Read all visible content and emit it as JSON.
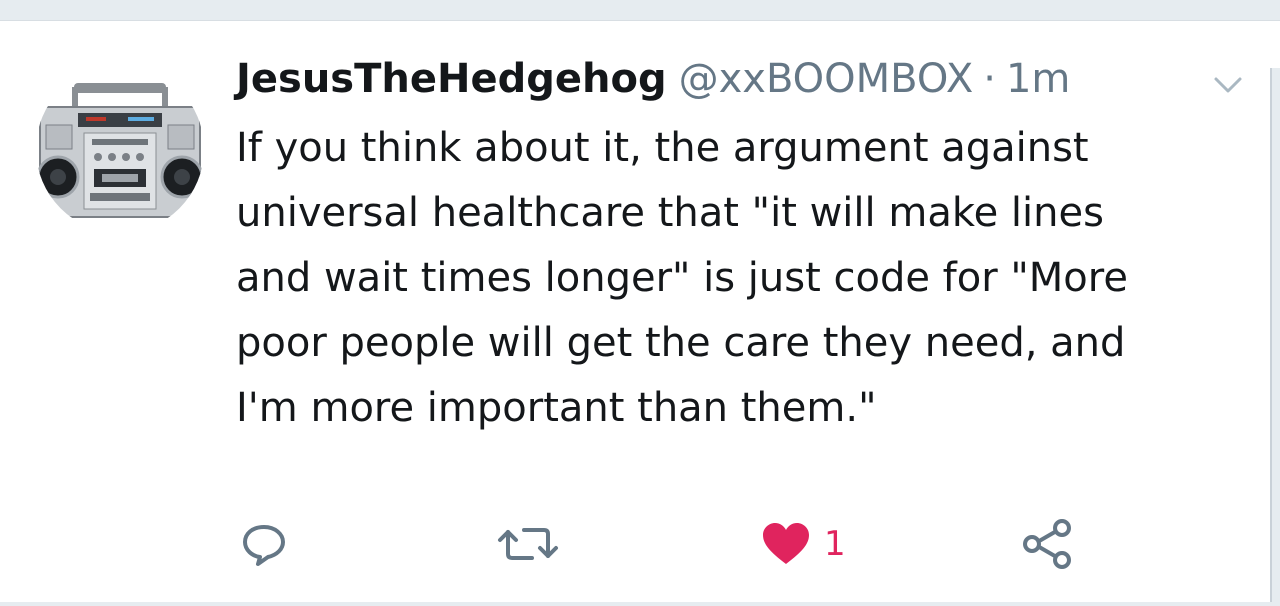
{
  "tweet": {
    "display_name": "JesusTheHedgehog",
    "handle": "@xxBOOMBOX",
    "separator": "·",
    "timestamp": "1m",
    "text": "If you think about it, the argument against\nuniversal healthcare that \"it will make lines\nand wait times longer\" is just code for \"More\npoor people will get the care they need, and\nI'm more important than them.\"",
    "avatar_icon": "boombox-avatar",
    "actions": {
      "reply_icon": "reply-icon",
      "retweet_icon": "retweet-icon",
      "like_icon": "heart-icon",
      "like_count": "1",
      "share_icon": "share-icon"
    }
  },
  "colors": {
    "text_primary": "#14171a",
    "text_secondary": "#657786",
    "like_red": "#e0245e",
    "divider": "#e6ecf0"
  }
}
